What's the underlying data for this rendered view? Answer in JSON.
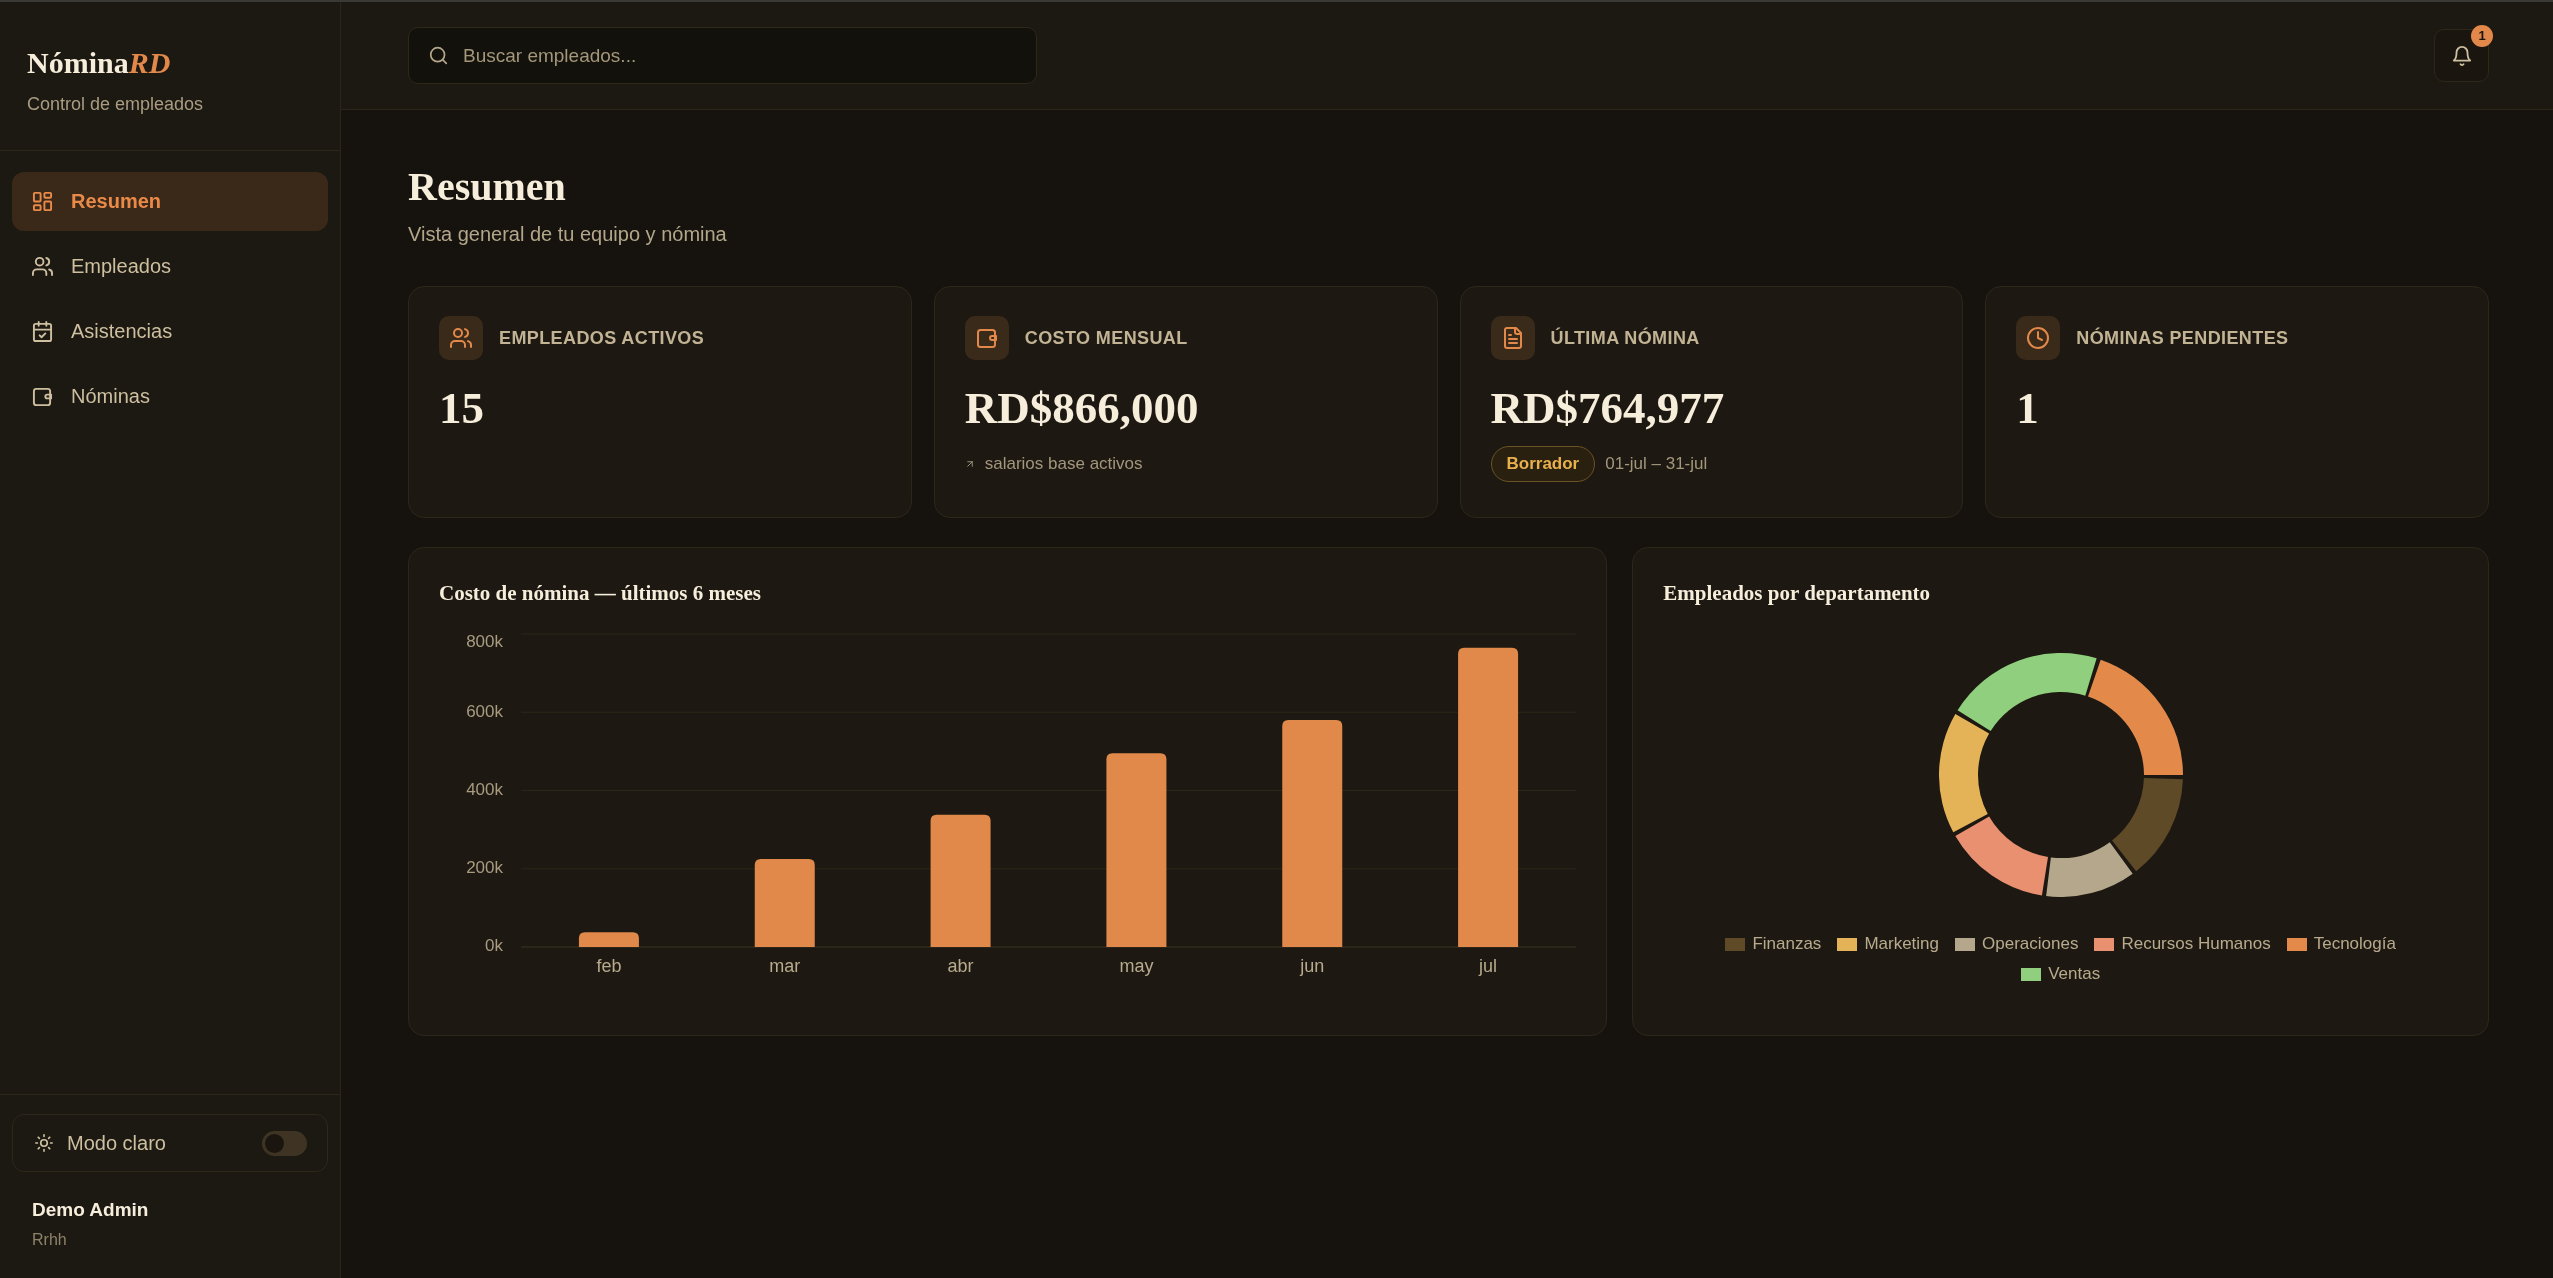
{
  "sidebar": {
    "logo": {
      "text": "Nómina",
      "accent": "RD"
    },
    "subtitle": "Control de empleados",
    "nav": [
      {
        "label": "Resumen",
        "selected": true
      },
      {
        "label": "Empleados",
        "selected": false
      },
      {
        "label": "Asistencias",
        "selected": false
      },
      {
        "label": "Nóminas",
        "selected": false
      }
    ],
    "theme_toggle": {
      "label": "Modo claro",
      "on": false
    },
    "user": {
      "name": "Demo Admin",
      "role": "Rrhh"
    }
  },
  "header": {
    "search": {
      "placeholder": "Buscar empleados..."
    },
    "notifications": {
      "count": "1"
    }
  },
  "page": {
    "title": "Resumen",
    "subtitle": "Vista general de tu equipo y nómina"
  },
  "stats": [
    {
      "kind": "plain",
      "label": "EMPLEADOS ACTIVOS",
      "value": "15"
    },
    {
      "kind": "trend",
      "label": "COSTO MENSUAL",
      "value": "RD$866,000",
      "note": "salarios base activos"
    },
    {
      "kind": "status",
      "label": "ÚLTIMA NÓMINA",
      "value": "RD$764,977",
      "status": "Borrador",
      "period": "01-jul – 31-jul"
    },
    {
      "kind": "plain",
      "label": "NÓMINAS PENDIENTES",
      "value": "1"
    }
  ],
  "payroll_chart": {
    "chart_data": {
      "type": "bar",
      "title": "Costo de nómina — últimos 6 meses",
      "categories": [
        "feb",
        "mar",
        "abr",
        "may",
        "jun",
        "jul"
      ],
      "series": [
        {
          "color": "#e0894a",
          "values": [
            38000,
            225000,
            338000,
            495000,
            580000,
            765000
          ]
        }
      ],
      "ylim": [
        0,
        800000
      ],
      "yticks": [
        {
          "value": 0,
          "label": "0k"
        },
        {
          "value": 200000,
          "label": "200k"
        },
        {
          "value": 400000,
          "label": "400k"
        },
        {
          "value": 600000,
          "label": "600k"
        },
        {
          "value": 800000,
          "label": "800k"
        }
      ],
      "grid": true
    }
  },
  "department_chart": {
    "title": "Empleados por departamento",
    "legend": [
      {
        "label": "Finanzas",
        "color": "#5f4a27"
      },
      {
        "label": "Marketing",
        "color": "#e5b357"
      },
      {
        "label": "Operaciones",
        "color": "#b4a78b"
      },
      {
        "label": "Recursos Humanos",
        "color": "#e89070"
      },
      {
        "label": "Tecnología",
        "color": "#e38a4b"
      },
      {
        "label": "Ventas",
        "color": "#90cf7d"
      }
    ]
  }
}
